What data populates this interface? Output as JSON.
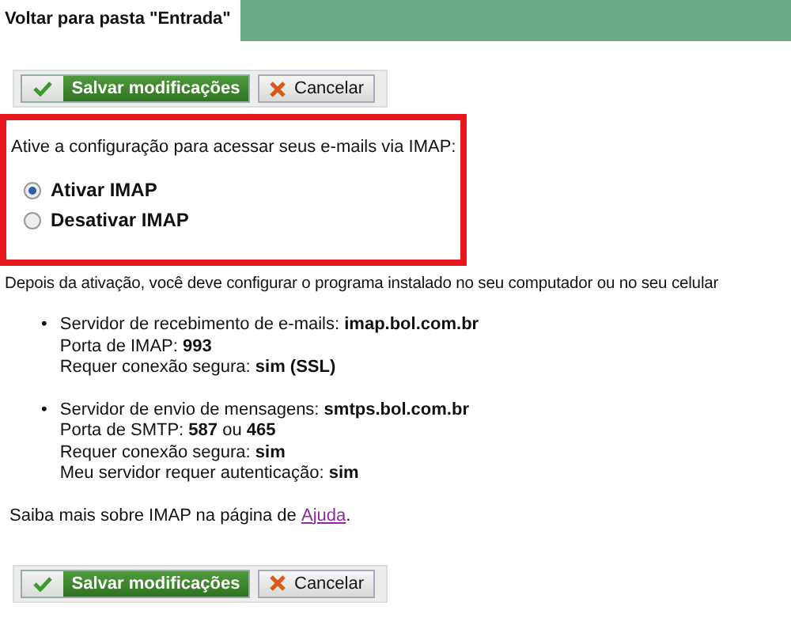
{
  "header": {
    "back_link": "Voltar para pasta \"Entrada\""
  },
  "toolbar_top": {
    "save": "Salvar modificações",
    "cancel": "Cancelar"
  },
  "imap_box": {
    "prompt": "Ative a configuração para acessar seus e-mails via IMAP:",
    "options": [
      {
        "label": "Ativar IMAP",
        "selected": true
      },
      {
        "label": "Desativar IMAP",
        "selected": false
      }
    ]
  },
  "instructions": "Depois da ativação, você deve configurar o programa instalado no seu computador ou no seu celular",
  "servers": [
    {
      "bullet": "•",
      "lines": [
        "Servidor de recebimento de e-mails: **imap.bol.com.br**",
        "Porta de IMAP: **993**",
        "Requer conexão segura: **sim (SSL)**"
      ]
    },
    {
      "bullet": "•",
      "lines": [
        "Servidor de envio de mensagens: **smtps.bol.com.br**",
        "Porta de SMTP: **587** ou **465**",
        "Requer conexão segura: **sim**",
        "Meu servidor requer autenticação: **sim**"
      ]
    }
  ],
  "help": {
    "text": "Saiba mais sobre IMAP na página de",
    "link": "Ajuda",
    "end": "."
  },
  "toolbar_bottom": {
    "save": "Salvar modificações",
    "cancel": "Cancelar"
  }
}
